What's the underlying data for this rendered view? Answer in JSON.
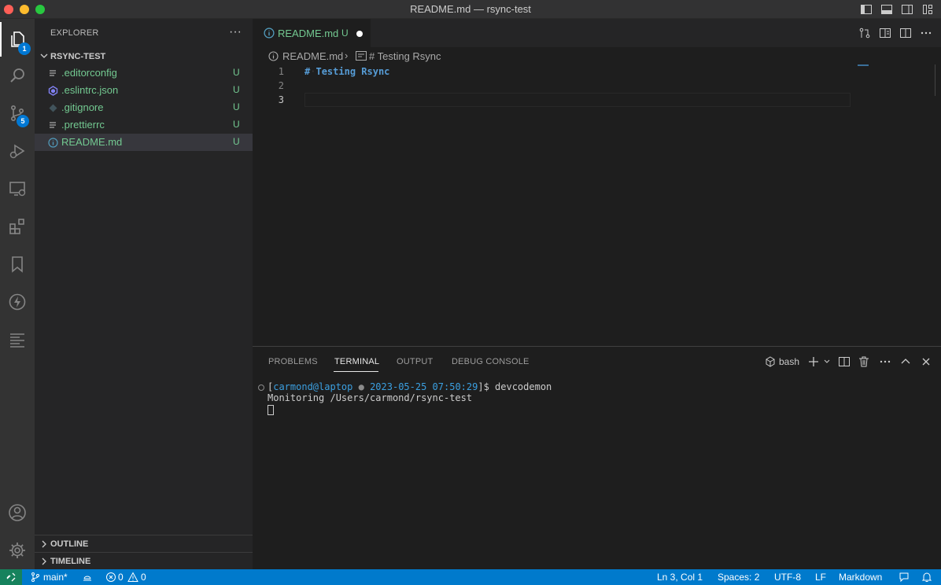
{
  "window": {
    "title": "README.md — rsync-test"
  },
  "activity_bar": {
    "explorer_badge": "1",
    "scm_badge": "5"
  },
  "sidebar": {
    "title": "EXPLORER",
    "more_label": "···",
    "folder_name": "RSYNC-TEST",
    "files": [
      {
        "name": ".editorconfig",
        "status": "U",
        "icon": "lines-icon",
        "selected": false
      },
      {
        "name": ".eslintrc.json",
        "status": "U",
        "icon": "eslint-icon",
        "selected": false
      },
      {
        "name": ".gitignore",
        "status": "U",
        "icon": "git-icon",
        "selected": false
      },
      {
        "name": ".prettierrc",
        "status": "U",
        "icon": "lines-icon",
        "selected": false
      },
      {
        "name": "README.md",
        "status": "U",
        "icon": "info-icon",
        "selected": true
      }
    ],
    "sections": [
      {
        "label": "OUTLINE"
      },
      {
        "label": "TIMELINE"
      }
    ]
  },
  "editor": {
    "tab": {
      "label": "README.md",
      "status": "U"
    },
    "breadcrumbs": {
      "file": "README.md",
      "symbol": "# Testing Rsync"
    },
    "lines": [
      {
        "number": "1",
        "hash": "#",
        "text": "Testing Rsync"
      },
      {
        "number": "2",
        "hash": "",
        "text": ""
      },
      {
        "number": "3",
        "hash": "",
        "text": ""
      }
    ]
  },
  "panel": {
    "tabs": [
      "PROBLEMS",
      "TERMINAL",
      "OUTPUT",
      "DEBUG CONSOLE"
    ],
    "active_tab": "TERMINAL",
    "shell": "bash",
    "terminal": {
      "prompt_open": "[",
      "user": "carmond@laptop",
      "sep": " ● ",
      "datetime": "2023-05-25 07:50:29",
      "prompt_close": "]$ devcodemon",
      "output": "Monitoring /Users/carmond/rsync-test"
    }
  },
  "status_bar": {
    "branch": "main*",
    "errors": "0",
    "warnings": "0",
    "position": "Ln 3, Col 1",
    "spaces": "Spaces: 2",
    "encoding": "UTF-8",
    "eol": "LF",
    "language": "Markdown"
  },
  "colors": {
    "accent": "#007acc",
    "untracked": "#73c991",
    "badge": "#0078d4",
    "remote": "#16825d"
  }
}
